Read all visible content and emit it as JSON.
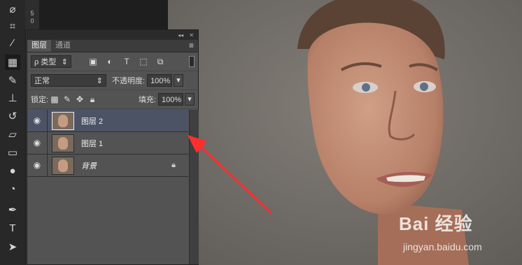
{
  "toolbar": {
    "tools": [
      "lasso-icon",
      "crop-icon",
      "eyedropper-icon",
      "patch-icon",
      "brush-icon",
      "stamp-icon",
      "history-brush-icon",
      "eraser-icon",
      "gradient-icon",
      "blur-icon",
      "dodge-icon",
      "pen-icon",
      "type-icon",
      "path-select-icon"
    ],
    "ruler_marks": [
      "5",
      "0"
    ]
  },
  "panel": {
    "collapse_glyph": "◂◂",
    "close_glyph": "✕",
    "tabs": [
      {
        "label": "图层",
        "active": true
      },
      {
        "label": "通道",
        "active": false
      }
    ],
    "menu_glyph": "≡",
    "filter": {
      "label": "ρ 类型",
      "arrow": "⇕"
    },
    "blend_mode": {
      "value": "正常",
      "arrow": "⇕"
    },
    "opacity": {
      "label": "不透明度:",
      "value": "100%",
      "arrow": "▾"
    },
    "lock_label": "锁定:",
    "fill": {
      "label": "填充:",
      "value": "100%",
      "arrow": "▾"
    },
    "layers": [
      {
        "name": "图层 2",
        "selected": true,
        "locked": false
      },
      {
        "name": "图层 1",
        "selected": false,
        "locked": false
      },
      {
        "name": "背景",
        "selected": false,
        "locked": true
      }
    ]
  },
  "watermark": {
    "brand": "Bai 经验",
    "url": "jingyan.baidu.com"
  },
  "colors": {
    "panel": "#535353",
    "selected_layer": "#4c5365",
    "arrow": "#ff2d2d"
  }
}
